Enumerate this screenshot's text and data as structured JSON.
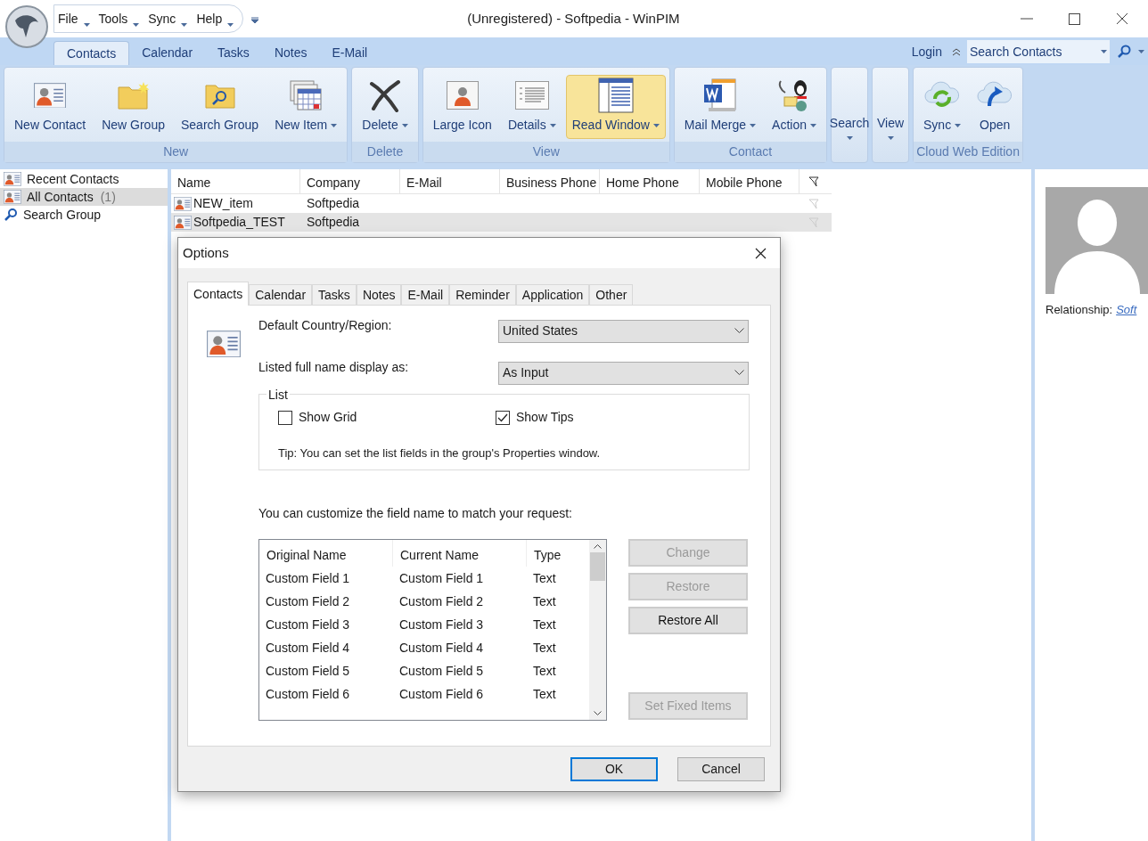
{
  "window": {
    "title": "(Unregistered) - Softpedia - WinPIM"
  },
  "menu": [
    "File",
    "Tools",
    "Sync",
    "Help"
  ],
  "tabs": [
    {
      "label": "Contacts",
      "selected": true
    },
    {
      "label": "Calendar",
      "selected": false
    },
    {
      "label": "Tasks",
      "selected": false
    },
    {
      "label": "Notes",
      "selected": false
    },
    {
      "label": "E-Mail",
      "selected": false
    }
  ],
  "login": "Login",
  "search": {
    "placeholder": "Search Contacts"
  },
  "ribbon": {
    "groups": [
      {
        "label": "New",
        "buttons": [
          {
            "label": "New Contact",
            "dropdown": false,
            "selected": false
          },
          {
            "label": "New Group",
            "dropdown": false,
            "selected": false
          },
          {
            "label": "Search Group",
            "dropdown": false,
            "selected": false
          },
          {
            "label": "New Item",
            "dropdown": true,
            "selected": false
          }
        ]
      },
      {
        "label": "Delete",
        "buttons": [
          {
            "label": "Delete",
            "dropdown": true,
            "selected": false
          }
        ]
      },
      {
        "label": "View",
        "buttons": [
          {
            "label": "Large Icon",
            "dropdown": false,
            "selected": false
          },
          {
            "label": "Details",
            "dropdown": true,
            "selected": false
          },
          {
            "label": "Read Window",
            "dropdown": true,
            "selected": true
          }
        ]
      },
      {
        "label": "Contact",
        "buttons": [
          {
            "label": "Mail Merge",
            "dropdown": true,
            "selected": false
          },
          {
            "label": "Action",
            "dropdown": true,
            "selected": false
          }
        ]
      },
      {
        "kind": "menu",
        "buttons": [
          {
            "label": "Search",
            "dropdown": true
          }
        ]
      },
      {
        "kind": "menu",
        "buttons": [
          {
            "label": "View",
            "dropdown": true
          }
        ]
      },
      {
        "label": "Cloud Web Edition",
        "buttons": [
          {
            "label": "Sync",
            "dropdown": true,
            "selected": false
          },
          {
            "label": "Open",
            "dropdown": false,
            "selected": false
          }
        ]
      }
    ]
  },
  "sidebar": {
    "items": [
      {
        "label": "Recent Contacts",
        "selected": false
      },
      {
        "label": "All Contacts",
        "count": "(1)",
        "selected": true
      },
      {
        "label": "Search Group",
        "selected": false
      }
    ]
  },
  "table": {
    "columns": [
      "Name",
      "Company",
      "E-Mail",
      "Business Phone",
      "Home Phone",
      "Mobile Phone"
    ],
    "rows": [
      {
        "name": "NEW_item",
        "company": "Softpedia",
        "selected": false
      },
      {
        "name": "Softpedia_TEST",
        "company": "Softpedia",
        "selected": true
      }
    ]
  },
  "details": {
    "label": "Relationship:",
    "link": "Soft"
  },
  "dialog": {
    "title": "Options",
    "tabs": [
      {
        "label": "Contacts",
        "selected": true
      },
      {
        "label": "Calendar",
        "selected": false
      },
      {
        "label": "Tasks",
        "selected": false
      },
      {
        "label": "Notes",
        "selected": false
      },
      {
        "label": "E-Mail",
        "selected": false
      },
      {
        "label": "Reminder",
        "selected": false
      },
      {
        "label": "Application",
        "selected": false
      },
      {
        "label": "Other",
        "selected": false
      }
    ],
    "fields": [
      {
        "label": "Default Country/Region:",
        "value": "United States"
      },
      {
        "label": "Listed full name display as:",
        "value": "As Input"
      }
    ],
    "list_group": {
      "title": "List",
      "checkboxes": [
        {
          "label": "Show Grid",
          "checked": false
        },
        {
          "label": "Show Tips",
          "checked": true
        }
      ],
      "tip": "Tip: You can set the list fields in the group's Properties window."
    },
    "customize_text": "You can customize the field name to match your request:",
    "field_table": {
      "columns": [
        "Original Name",
        "Current Name",
        "Type"
      ],
      "rows": [
        {
          "original": "Custom Field 1",
          "current": "Custom Field 1",
          "type": "Text"
        },
        {
          "original": "Custom Field 2",
          "current": "Custom Field 2",
          "type": "Text"
        },
        {
          "original": "Custom Field 3",
          "current": "Custom Field 3",
          "type": "Text"
        },
        {
          "original": "Custom Field 4",
          "current": "Custom Field 4",
          "type": "Text"
        },
        {
          "original": "Custom Field 5",
          "current": "Custom Field 5",
          "type": "Text"
        },
        {
          "original": "Custom Field 6",
          "current": "Custom Field 6",
          "type": "Text"
        }
      ]
    },
    "side_buttons": [
      {
        "label": "Change",
        "disabled": true
      },
      {
        "label": "Restore",
        "disabled": true
      },
      {
        "label": "Restore All",
        "disabled": false
      },
      {
        "label": "Set Fixed Items",
        "disabled": true
      }
    ],
    "buttons": [
      {
        "label": "OK",
        "default": true
      },
      {
        "label": "Cancel",
        "default": false
      }
    ]
  }
}
